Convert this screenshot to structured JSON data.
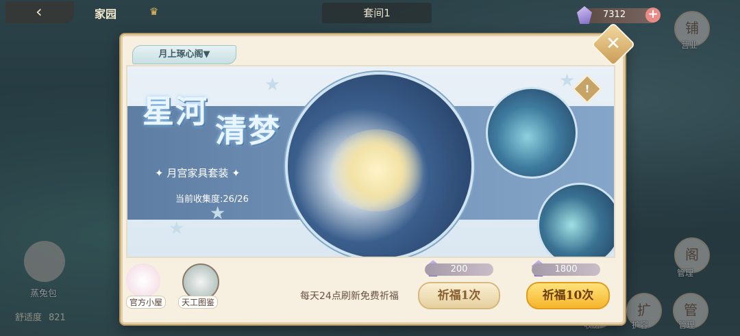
{
  "topbar": {
    "title": "家园",
    "center_tab": "套间1",
    "currency_value": "7312"
  },
  "side": {
    "right_top_label": "营业",
    "right_mid_label": "管理",
    "bottom_right_labels": [
      "收房",
      "扩容",
      "管理"
    ],
    "left_avatar_label": "蒸兔包",
    "comfort_label": "舒适度",
    "comfort_value": "821"
  },
  "modal": {
    "tab_label": "月上琢心阁▼",
    "close_label": "✕",
    "banner": {
      "title_line1": "星河",
      "title_line2": "清梦",
      "subtitle": "月宫家具套装",
      "progress": "当前收集度:26/26"
    },
    "bottom_icons": [
      {
        "label": "官方小屋"
      },
      {
        "label": "天工图鉴"
      }
    ],
    "info_text": "每天24点刷新免费祈福",
    "draw_once": {
      "cost": "200",
      "label": "祈福1次"
    },
    "draw_ten": {
      "cost": "1800",
      "label": "祈福10次"
    }
  }
}
